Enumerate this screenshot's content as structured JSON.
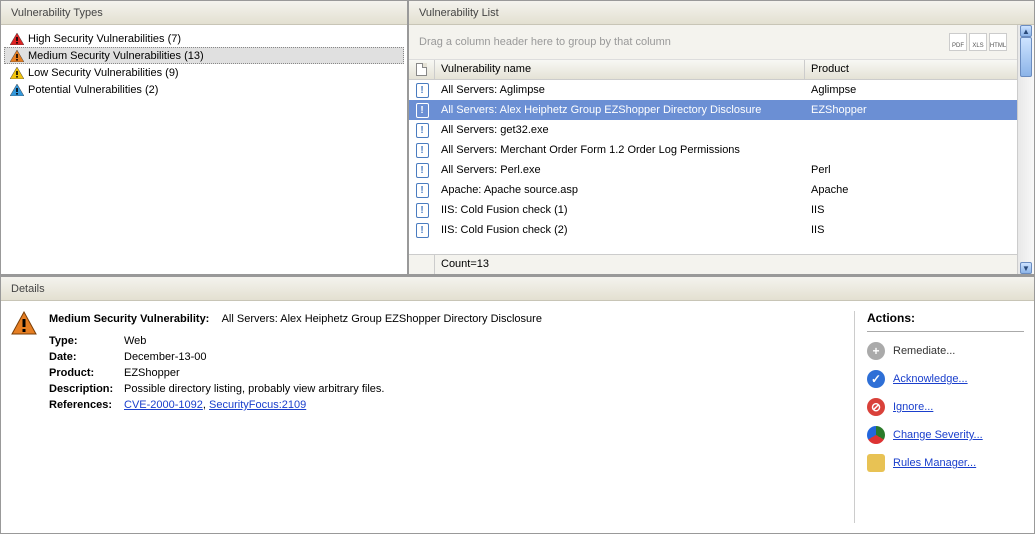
{
  "panels": {
    "left_title": "Vulnerability Types",
    "right_title": "Vulnerability List",
    "details_title": "Details",
    "group_hint": "Drag a column header here to group by that column"
  },
  "exports": [
    "PDF",
    "XLS",
    "HTML"
  ],
  "tree": {
    "items": [
      {
        "label": "High Security Vulnerabilities (7)",
        "color": "#d22",
        "selected": false
      },
      {
        "label": "Medium Security Vulnerabilities (13)",
        "color": "#e67e22",
        "selected": true
      },
      {
        "label": "Low Security Vulnerabilities (9)",
        "color": "#f1c40f",
        "selected": false
      },
      {
        "label": "Potential Vulnerabilities (2)",
        "color": "#3498db",
        "selected": false
      }
    ]
  },
  "grid": {
    "headers": {
      "name": "Vulnerability name",
      "product": "Product"
    },
    "rows": [
      {
        "name": "All Servers: Aglimpse",
        "product": "Aglimpse",
        "selected": false
      },
      {
        "name": "All Servers: Alex Heiphetz Group EZShopper Directory Disclosure",
        "product": "EZShopper",
        "selected": true
      },
      {
        "name": "All Servers: get32.exe",
        "product": "",
        "selected": false
      },
      {
        "name": "All Servers: Merchant Order Form 1.2 Order Log Permissions",
        "product": "",
        "selected": false
      },
      {
        "name": "All Servers: Perl.exe",
        "product": "Perl",
        "selected": false
      },
      {
        "name": "Apache: Apache source.asp",
        "product": "Apache",
        "selected": false
      },
      {
        "name": "IIS: Cold Fusion check (1)",
        "product": "IIS",
        "selected": false
      },
      {
        "name": "IIS: Cold Fusion check (2)",
        "product": "IIS",
        "selected": false
      }
    ],
    "footer": "Count=13"
  },
  "details": {
    "severity_label": "Medium Security Vulnerability:",
    "title": "All Servers: Alex Heiphetz Group EZShopper Directory Disclosure",
    "fields": {
      "type_label": "Type:",
      "type_value": "Web",
      "date_label": "Date:",
      "date_value": "December-13-00",
      "product_label": "Product:",
      "product_value": "EZShopper",
      "desc_label": "Description:",
      "desc_value": "Possible directory listing, probably view arbitrary files.",
      "ref_label": "References:",
      "ref1": "CVE-2000-1092",
      "ref2": "SecurityFocus:2109"
    },
    "icon_color": "#e67e22"
  },
  "actions": {
    "header": "Actions:",
    "items": [
      {
        "label": "Remediate...",
        "color": "#aaa",
        "glyph": "+",
        "underline": false
      },
      {
        "label": "Acknowledge...",
        "color": "#2e6fd6",
        "glyph": "✓",
        "underline": true
      },
      {
        "label": "Ignore...",
        "color": "#d9413a",
        "glyph": "⊘",
        "underline": true
      },
      {
        "label": "Change Severity...",
        "color": "",
        "glyph": "",
        "underline": true,
        "pie": true
      },
      {
        "label": "Rules Manager...",
        "color": "#e8c254",
        "glyph": "",
        "underline": true,
        "square": true
      }
    ]
  }
}
